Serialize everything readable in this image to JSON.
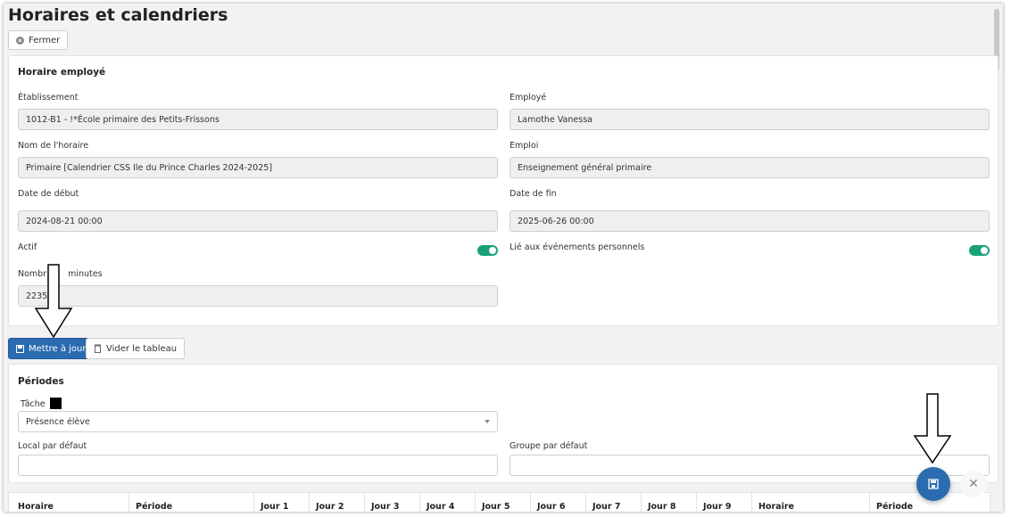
{
  "page_title": "Horaires et calendriers",
  "close_button": "Fermer",
  "employee_schedule": {
    "title": "Horaire employé",
    "etablissement": {
      "label": "Établissement",
      "value": "1012-B1 - !*École primaire des Petits-Frissons"
    },
    "employe": {
      "label": "Employé",
      "value": "Lamothe Vanessa"
    },
    "nom_horaire": {
      "label": "Nom de l'horaire",
      "value": "Primaire [Calendrier CSS Ile du Prince Charles 2024-2025]"
    },
    "emploi": {
      "label": "Emploi",
      "value": "Enseignement général primaire"
    },
    "date_debut": {
      "label": "Date de début",
      "value": "2024-08-21 00:00"
    },
    "date_fin": {
      "label": "Date de fin",
      "value": "2025-06-26 00:00"
    },
    "actif": {
      "label": "Actif",
      "on": true
    },
    "lie_evenements": {
      "label": "Lié aux événements personnels",
      "on": true
    },
    "nombre_minutes": {
      "label_left": "Nombr",
      "label_right": "minutes",
      "value": "2235"
    }
  },
  "toolbar": {
    "update_label": "Mettre à jour",
    "clear_label": "Vider le tableau"
  },
  "periodes": {
    "title": "Périodes",
    "tache": {
      "label": "Tâche",
      "value": "Présence élève"
    },
    "local": {
      "label": "Local par défaut",
      "value": ""
    },
    "groupe": {
      "label": "Groupe par défaut",
      "value": ""
    }
  },
  "table_headers": [
    "Horaire",
    "Période",
    "Jour 1",
    "Jour 2",
    "Jour 3",
    "Jour 4",
    "Jour 5",
    "Jour 6",
    "Jour 7",
    "Jour 8",
    "Jour 9",
    "Horaire",
    "Période"
  ],
  "fab_close_symbol": "✕",
  "colors": {
    "primary": "#2b6cb0",
    "toggle_on": "#1aa179"
  }
}
